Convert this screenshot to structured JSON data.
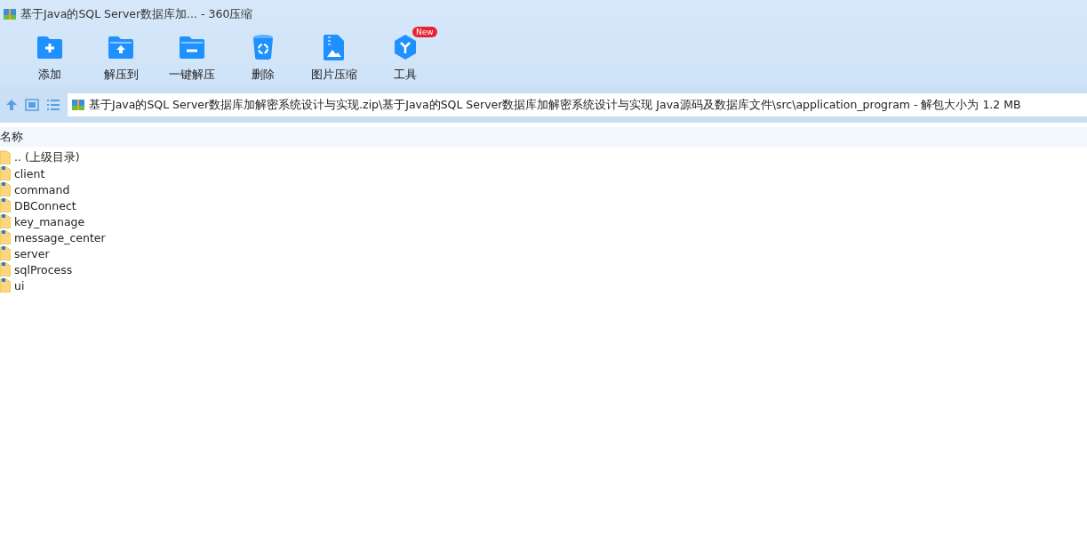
{
  "window": {
    "title": "基于Java的SQL Server数据库加... - 360压缩"
  },
  "toolbar": [
    {
      "label": "添加",
      "kind": "add"
    },
    {
      "label": "解压到",
      "kind": "extract"
    },
    {
      "label": "一键解压",
      "kind": "quick"
    },
    {
      "label": "删除",
      "kind": "delete"
    },
    {
      "label": "图片压缩",
      "kind": "image"
    },
    {
      "label": "工具",
      "kind": "tools",
      "badge": "New"
    }
  ],
  "address": {
    "path": "基于Java的SQL Server数据库加解密系统设计与实现.zip\\基于Java的SQL Server数据库加解密系统设计与实现 Java源码及数据库文件\\src\\application_program - 解包大小为 1.2 MB"
  },
  "file_list": {
    "columns": [
      "名称"
    ],
    "rows": [
      {
        "name": ".. (上级目录)",
        "kind": "parent"
      },
      {
        "name": "client",
        "kind": "folder"
      },
      {
        "name": "command",
        "kind": "folder"
      },
      {
        "name": "DBConnect",
        "kind": "folder"
      },
      {
        "name": "key_manage",
        "kind": "folder"
      },
      {
        "name": "message_center",
        "kind": "folder"
      },
      {
        "name": "server",
        "kind": "folder"
      },
      {
        "name": "sqlProcess",
        "kind": "folder"
      },
      {
        "name": "ui",
        "kind": "folder"
      }
    ]
  }
}
